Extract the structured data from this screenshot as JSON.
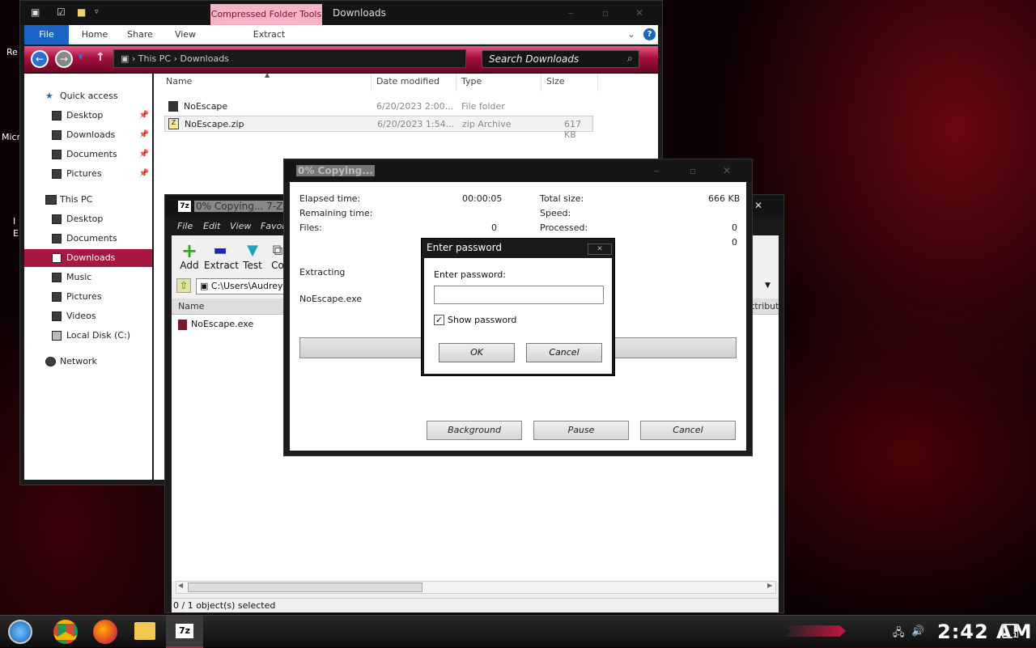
{
  "desktop": {
    "icon1": "Re",
    "icon2": "Micr",
    "icon3": "I",
    "icon4": "E"
  },
  "explorer": {
    "qat_icons": [
      "properties-icon",
      "check-icon",
      "new-folder-icon",
      "dropdown-icon"
    ],
    "context_tab": "Compressed Folder Tools",
    "title": "Downloads",
    "ribbon_tabs": {
      "file": "File",
      "home": "Home",
      "share": "Share",
      "view": "View",
      "extract": "Extract"
    },
    "address": {
      "root": "This PC",
      "sep": "›",
      "folder": "Downloads"
    },
    "search_placeholder": "Search Downloads",
    "nav": {
      "quick_access": "Quick access",
      "qa_desktop": "Desktop",
      "qa_downloads": "Downloads",
      "qa_documents": "Documents",
      "qa_pictures": "Pictures",
      "this_pc": "This PC",
      "pc_desktop": "Desktop",
      "pc_documents": "Documents",
      "pc_downloads": "Downloads",
      "pc_music": "Music",
      "pc_pictures": "Pictures",
      "pc_videos": "Videos",
      "pc_local_disk": "Local Disk (C:)",
      "network": "Network"
    },
    "columns": {
      "name": "Name",
      "date": "Date modified",
      "type": "Type",
      "size": "Size"
    },
    "files": [
      {
        "name": "NoEscape",
        "date": "6/20/2023 2:00...",
        "type": "File folder",
        "size": ""
      },
      {
        "name": "NoEscape.zip",
        "date": "6/20/2023 1:54...",
        "type": "zip Archive",
        "size": "617 KB"
      }
    ]
  },
  "zip": {
    "title": "0% Copying... 7-Zi",
    "menu": {
      "file": "File",
      "edit": "Edit",
      "view": "View",
      "favorites": "Favor"
    },
    "tools": {
      "add": "Add",
      "extract": "Extract",
      "test": "Test",
      "copy": "Co"
    },
    "path": "C:\\Users\\Audrey",
    "col_name": "Name",
    "col_attr": "ttribute",
    "item": "NoEscape.exe",
    "status": "0 / 1 object(s) selected"
  },
  "copy": {
    "title": "0% Copying...",
    "elapsed_label": "Elapsed time:",
    "elapsed_value": "00:00:05",
    "remaining_label": "Remaining time:",
    "files_label": "Files:",
    "files_value": "0",
    "total_label": "Total size:",
    "total_value": "666 KB",
    "speed_label": "Speed:",
    "processed_label": "Processed:",
    "processed_value": "0",
    "extra_value": "0",
    "status": "Extracting",
    "file": "NoEscape.exe",
    "btn_background": "Background",
    "btn_pause": "Pause",
    "btn_cancel": "Cancel"
  },
  "password": {
    "title": "Enter password",
    "label": "Enter password:",
    "value": "",
    "show_label": "Show password",
    "show_checked": true,
    "ok": "OK",
    "cancel": "Cancel"
  },
  "taskbar": {
    "clock": "2:42 AM",
    "notification_count": "1"
  }
}
